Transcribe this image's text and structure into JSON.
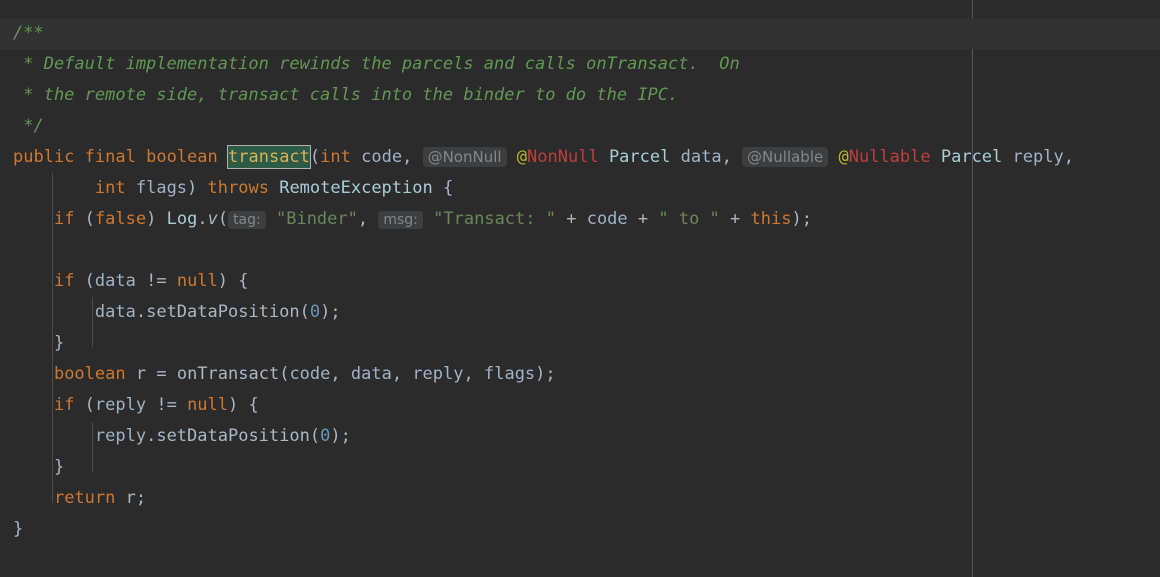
{
  "editor": {
    "background": "#2b2b2b",
    "caret_line_background": "#323232",
    "margin_guide_color": "#555759",
    "indent_guide_color": "#4b4b4b",
    "font_size_px": 17,
    "line_height_px": 31,
    "right_margin_column_x": 972
  },
  "colors": {
    "keyword": "#cc7832",
    "comment": "#629755",
    "string": "#6a8759",
    "number": "#6897bb",
    "identifier": "#a9b7c6",
    "parameter": "#9fb3c7",
    "type": "#a9ccd9",
    "annotation_at": "#bbb529",
    "annotation_name": "#bc3f3c",
    "inlay_hint_bg": "#3c3f41",
    "inlay_hint_fg": "#868686",
    "occurrence_bg": "#2e5b45",
    "occurrence_border": "#b0b0b0",
    "occurrence_fg": "#ddb05a"
  },
  "code": {
    "language": "java",
    "lines": [
      {
        "n": 1,
        "caret": true,
        "text": "/**"
      },
      {
        "n": 2,
        "caret": false,
        "text": " * Default implementation rewinds the parcels and calls onTransact.  On"
      },
      {
        "n": 3,
        "caret": false,
        "text": " * the remote side, transact calls into the binder to do the IPC."
      },
      {
        "n": 4,
        "caret": false,
        "text": " */"
      },
      {
        "n": 5,
        "caret": false,
        "text": "public final boolean transact(int code, @NonNull Parcel data, @Nullable Parcel reply,"
      },
      {
        "n": 6,
        "caret": false,
        "text": "        int flags) throws RemoteException {"
      },
      {
        "n": 7,
        "caret": false,
        "text": "    if (false) Log.v(\"Binder\", \"Transact: \" + code + \" to \" + this);"
      },
      {
        "n": 8,
        "caret": false,
        "text": ""
      },
      {
        "n": 9,
        "caret": false,
        "text": "    if (data != null) {"
      },
      {
        "n": 10,
        "caret": false,
        "text": "        data.setDataPosition(0);"
      },
      {
        "n": 11,
        "caret": false,
        "text": "    }"
      },
      {
        "n": 12,
        "caret": false,
        "text": "    boolean r = onTransact(code, data, reply, flags);"
      },
      {
        "n": 13,
        "caret": false,
        "text": "    if (reply != null) {"
      },
      {
        "n": 14,
        "caret": false,
        "text": "        reply.setDataPosition(0);"
      },
      {
        "n": 15,
        "caret": false,
        "text": "    }"
      },
      {
        "n": 16,
        "caret": false,
        "text": "    return r;"
      },
      {
        "n": 17,
        "caret": false,
        "text": "}"
      }
    ],
    "tokens": {
      "comment_open": "/**",
      "comment_line_1": " * Default implementation rewinds the parcels and calls onTransact.  On",
      "comment_line_2": " * the remote side, transact calls into the binder to do the IPC.",
      "comment_close": " */",
      "kw_public": "public",
      "kw_final": "final",
      "kw_boolean": "boolean",
      "method_transact": "transact",
      "kw_int": "int",
      "param_code": "code",
      "type_parcel": "Parcel",
      "param_data": "data",
      "param_reply": "reply",
      "param_flags": "flags",
      "kw_throws": "throws",
      "type_remote_exception": "RemoteException",
      "kw_if": "if",
      "kw_false": "false",
      "kw_null": "null",
      "kw_return": "return",
      "kw_this": "this",
      "type_log": "Log",
      "method_v": "v",
      "method_set_data_position": "setDataPosition",
      "method_on_transact": "onTransact",
      "var_r": "r",
      "num_zero": "0",
      "str_binder": "\"Binder\"",
      "str_transact": "\"Transact: \"",
      "str_to": "\" to \"",
      "at_sigil": "@",
      "anno_nonnull": "NonNull",
      "anno_nullable": "Nullable"
    },
    "inlay_hints": [
      {
        "label": "@NonNull",
        "kind": "annotation-hint"
      },
      {
        "label": "@Nullable",
        "kind": "annotation-hint"
      },
      {
        "label": "tag:",
        "kind": "parameter-hint"
      },
      {
        "label": "msg:",
        "kind": "parameter-hint"
      }
    ]
  }
}
